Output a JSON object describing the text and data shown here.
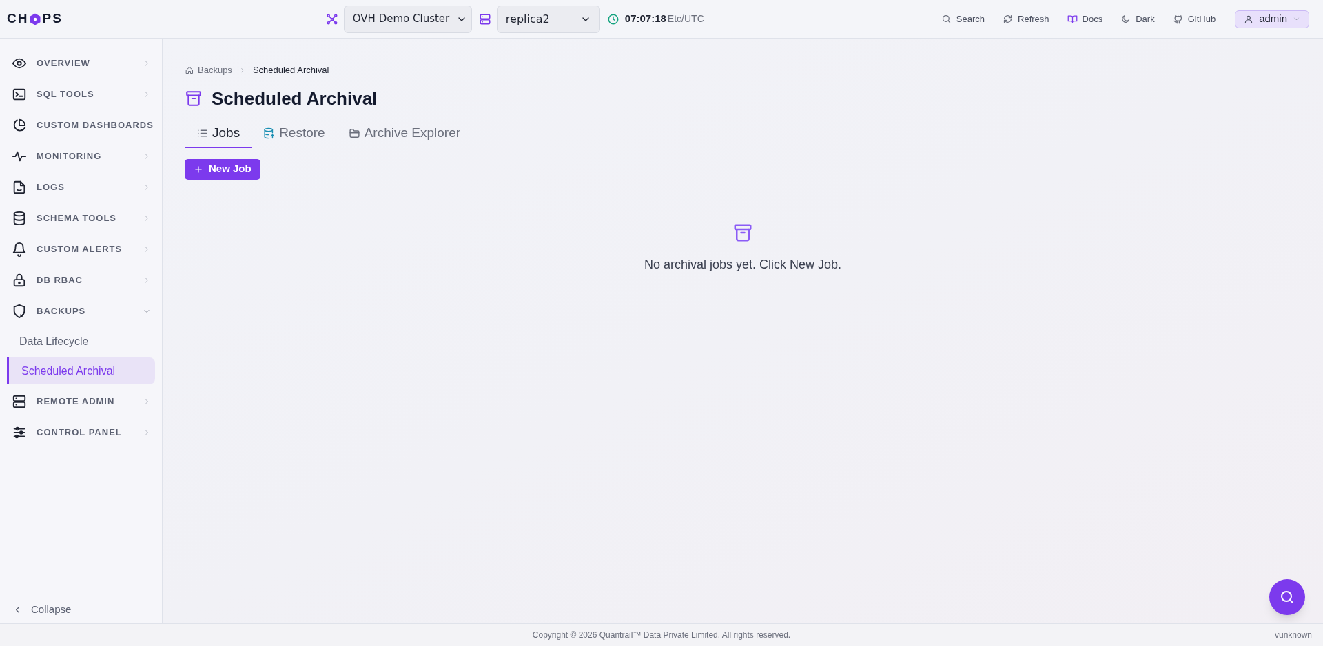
{
  "header": {
    "logo": {
      "left": "CH",
      "right": "PS"
    },
    "cluster": "OVH Demo Cluster",
    "replica": "replica2",
    "time": "07:07:18",
    "timezone": "Etc/UTC",
    "actions": [
      {
        "label": "Search"
      },
      {
        "label": "Refresh"
      },
      {
        "label": "Docs"
      },
      {
        "label": "Dark"
      },
      {
        "label": "GitHub"
      }
    ],
    "user": "admin"
  },
  "sidebar": {
    "items": [
      {
        "label": "OVERVIEW",
        "expanded": false
      },
      {
        "label": "SQL TOOLS",
        "expanded": false
      },
      {
        "label": "CUSTOM DASHBOARDS"
      },
      {
        "label": "MONITORING",
        "expanded": false
      },
      {
        "label": "LOGS",
        "expanded": false
      },
      {
        "label": "SCHEMA TOOLS",
        "expanded": false
      },
      {
        "label": "CUSTOM ALERTS",
        "expanded": false
      },
      {
        "label": "DB RBAC",
        "expanded": false
      },
      {
        "label": "BACKUPS",
        "expanded": true,
        "children": [
          {
            "label": "Data Lifecycle",
            "selected": false
          },
          {
            "label": "Scheduled Archival",
            "selected": true
          }
        ]
      },
      {
        "label": "REMOTE ADMIN",
        "expanded": false
      },
      {
        "label": "CONTROL PANEL",
        "expanded": false
      }
    ],
    "collapse": "Collapse"
  },
  "breadcrumb": [
    "Backups",
    "Scheduled Archival"
  ],
  "title": "Scheduled Archival",
  "tabs": [
    {
      "label": "Jobs",
      "selected": true
    },
    {
      "label": "Restore",
      "selected": false
    },
    {
      "label": "Archive Explorer",
      "selected": false
    }
  ],
  "new_job": "New Job",
  "empty_state": "No archival jobs yet. Click New Job.",
  "footer": {
    "copyright": "Copyright © 2026 Quantrail™ Data Private Limited. All rights reserved.",
    "version": "vunknown"
  }
}
